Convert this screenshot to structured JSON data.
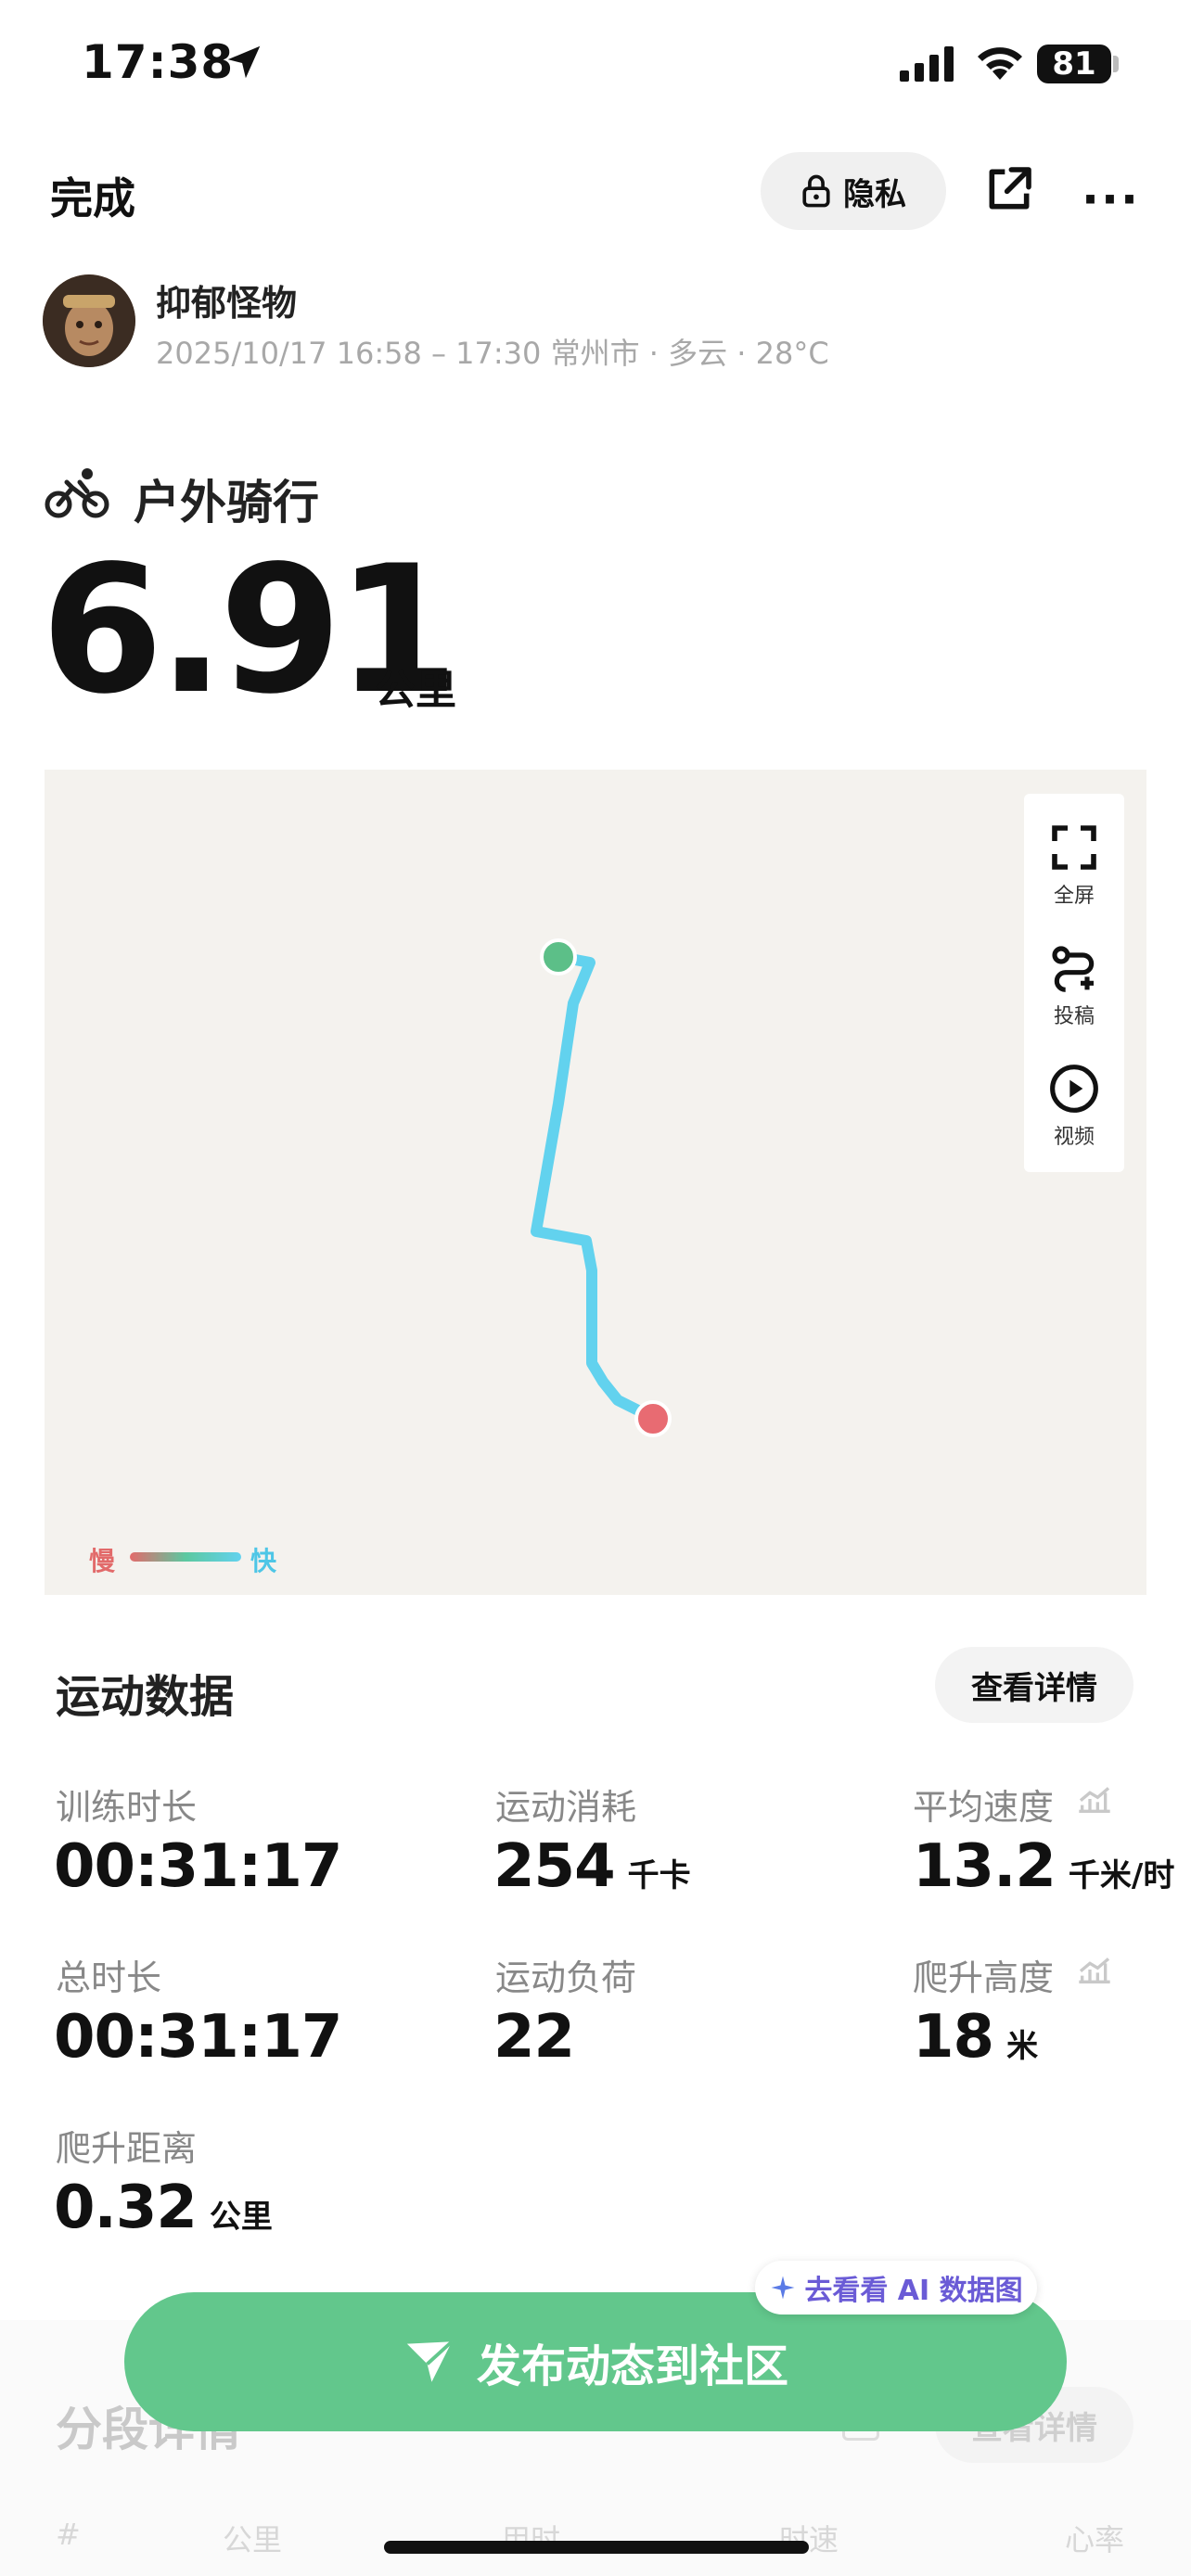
{
  "status_bar": {
    "time": "17:38",
    "battery": "81"
  },
  "header": {
    "done_label": "完成",
    "privacy_label": "隐私"
  },
  "user": {
    "name": "抑郁怪物",
    "meta": "2025/10/17 16:58 – 17:30 常州市 · 多云 · 28°C"
  },
  "activity": {
    "type_label": "户外骑行",
    "distance": "6.91",
    "distance_unit": "公里"
  },
  "map": {
    "tools": [
      {
        "label": "全屏",
        "icon": "fullscreen-icon"
      },
      {
        "label": "投稿",
        "icon": "route-plus-icon"
      },
      {
        "label": "视频",
        "icon": "play-icon"
      }
    ],
    "legend_slow": "慢",
    "legend_fast": "快",
    "colors": {
      "start": "#5cbf88",
      "end": "#e86b72",
      "track": "#62d2ee"
    }
  },
  "stats": {
    "title": "运动数据",
    "detail_label": "查看详情",
    "items": [
      {
        "label": "训练时长",
        "value": "00:31:17",
        "unit": ""
      },
      {
        "label": "运动消耗",
        "value": "254",
        "unit": "千卡"
      },
      {
        "label": "平均速度",
        "value": "13.2",
        "unit": "千米/时"
      },
      {
        "label": "总时长",
        "value": "00:31:17",
        "unit": ""
      },
      {
        "label": "运动负荷",
        "value": "22",
        "unit": ""
      },
      {
        "label": "爬升高度",
        "value": "18",
        "unit": "米"
      },
      {
        "label": "爬升距离",
        "value": "0.32",
        "unit": "公里"
      }
    ]
  },
  "ai_chip": {
    "label": "去看看 AI 数据图"
  },
  "segments": {
    "title": "分段详情",
    "detail_label": "查看详情",
    "columns": [
      "#",
      "公里",
      "用时",
      "时速",
      "心率"
    ]
  },
  "publish": {
    "label": "发布动态到社区",
    "color": "#62c78c"
  }
}
